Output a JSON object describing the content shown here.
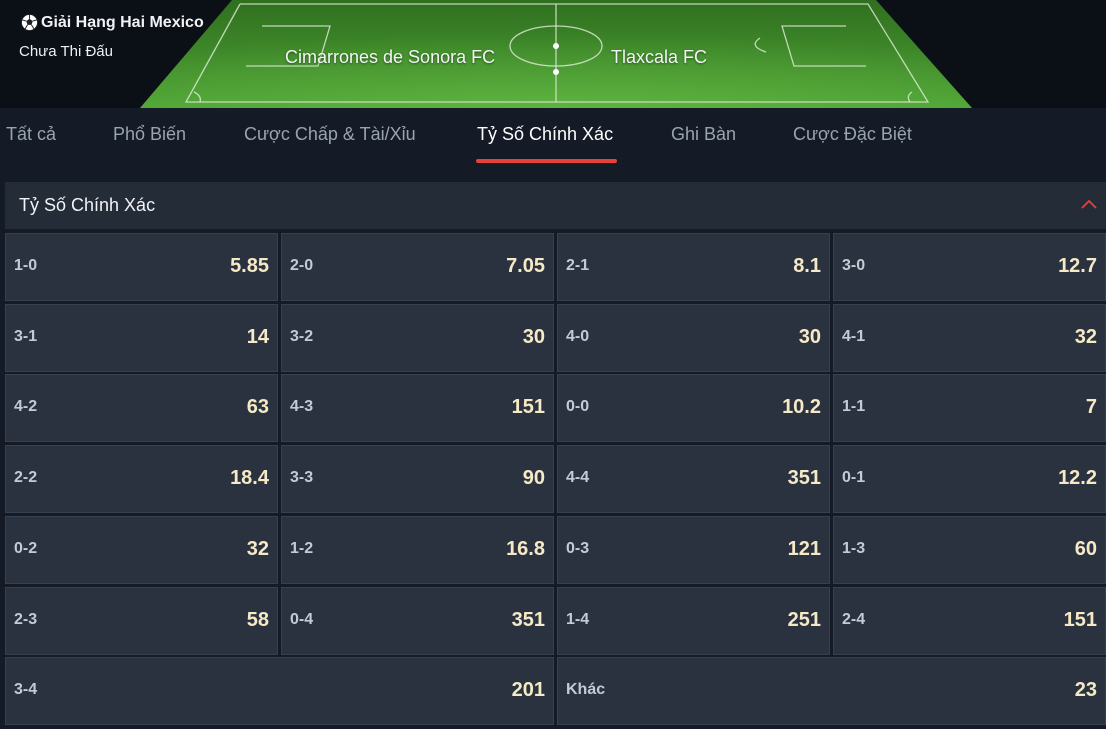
{
  "header": {
    "league": "Giải Hạng Hai Mexico",
    "status": "Chưa Thi Đấu",
    "home_team": "Cimarrones de Sonora FC",
    "away_team": "Tlaxcala FC",
    "icons": {
      "league": "soccer-ball-icon"
    },
    "colors": {
      "pitch": "#3f8f2a",
      "pitch_lines": "#d8e8d0"
    }
  },
  "tabs": [
    {
      "label": "Tất cả",
      "active": false
    },
    {
      "label": "Phổ Biến",
      "active": false
    },
    {
      "label": "Cược Chấp & Tài/Xỉu",
      "active": false
    },
    {
      "label": "Tỷ Số Chính Xác",
      "active": true
    },
    {
      "label": "Ghi Bàn",
      "active": false
    },
    {
      "label": "Cược Đặc Biệt",
      "active": false
    }
  ],
  "market": {
    "title": "Tỷ Số Chính Xác",
    "collapse_icon": "chevron-up-icon",
    "accent_color": "#e8403a",
    "selections": [
      {
        "score": "1-0",
        "odds": "5.85"
      },
      {
        "score": "2-0",
        "odds": "7.05"
      },
      {
        "score": "2-1",
        "odds": "8.1"
      },
      {
        "score": "3-0",
        "odds": "12.7"
      },
      {
        "score": "3-1",
        "odds": "14"
      },
      {
        "score": "3-2",
        "odds": "30"
      },
      {
        "score": "4-0",
        "odds": "30"
      },
      {
        "score": "4-1",
        "odds": "32"
      },
      {
        "score": "4-2",
        "odds": "63"
      },
      {
        "score": "4-3",
        "odds": "151"
      },
      {
        "score": "0-0",
        "odds": "10.2"
      },
      {
        "score": "1-1",
        "odds": "7"
      },
      {
        "score": "2-2",
        "odds": "18.4"
      },
      {
        "score": "3-3",
        "odds": "90"
      },
      {
        "score": "4-4",
        "odds": "351"
      },
      {
        "score": "0-1",
        "odds": "12.2"
      },
      {
        "score": "0-2",
        "odds": "32"
      },
      {
        "score": "1-2",
        "odds": "16.8"
      },
      {
        "score": "0-3",
        "odds": "121"
      },
      {
        "score": "1-3",
        "odds": "60"
      },
      {
        "score": "2-3",
        "odds": "58"
      },
      {
        "score": "0-4",
        "odds": "351"
      },
      {
        "score": "1-4",
        "odds": "251"
      },
      {
        "score": "2-4",
        "odds": "151"
      },
      {
        "score": "3-4",
        "odds": "201"
      },
      {
        "score": "Khác",
        "odds": "23"
      }
    ]
  }
}
